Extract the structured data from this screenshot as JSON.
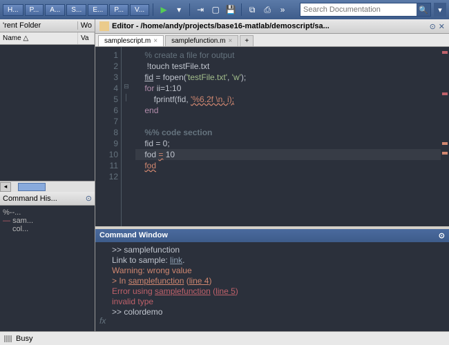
{
  "toolbar": {
    "tabs": [
      "H...",
      "P...",
      "A...",
      "S...",
      "E...",
      "P...",
      "V..."
    ],
    "search_placeholder": "Search Documentation"
  },
  "folder_panel": {
    "title": "'rent Folder",
    "tab2": "Wo",
    "cols": {
      "name": "Name △",
      "val": "Va"
    }
  },
  "history_panel": {
    "title": "Command His...",
    "lines": [
      "%--...",
      "sam...",
      "col..."
    ]
  },
  "editor": {
    "title": "Editor - /home/andy/projects/base16-matlab/demoscript/sa...",
    "tabs": [
      {
        "label": "samplescript.m",
        "active": true
      },
      {
        "label": "samplefunction.m",
        "active": false
      }
    ],
    "lines": [
      "1",
      "2",
      "3",
      "4",
      "5",
      "6",
      "7",
      "8",
      "9",
      "10",
      "11",
      "12"
    ],
    "code": {
      "l1": "    % create a file for output",
      "l2": "     !touch testFile.txt",
      "l3a": "    ",
      "l3_fid": "fid",
      "l3b": " = fopen(",
      "l3_s1": "'testFile.txt'",
      "l3c": ", ",
      "l3_s2": "'w'",
      "l3d": ");",
      "l4a": "    ",
      "l4_for": "for",
      "l4b": " ii=1:10",
      "l5a": "        fprintf(fid, ",
      "l5_warn": "'%6.2f \\n, i);",
      "l6a": "    ",
      "l6_end": "end",
      "l8": "    %% code section",
      "l9": "    fid = 0;",
      "l10a": "    fod ",
      "l10_eq": "=",
      "l10b": " 10",
      "l11a": "    ",
      "l11_fod": "fod"
    }
  },
  "command": {
    "title": "Command Window",
    "l1": ">> samplefunction",
    "l2a": "Link to sample: ",
    "l2_link": "link",
    "l2b": ".",
    "l3": "Warning: wrong value",
    "l4a": "> In ",
    "l4_fn": "samplefunction",
    "l4b": " (",
    "l4_ln": "line 4",
    "l4c": ")",
    "l5a": "Error using ",
    "l5_fn": "samplefunction",
    "l5b": " (",
    "l5_ln": "line 5",
    "l5c": ")",
    "l6": "invalid type",
    "l7": ">> colordemo",
    "fx": "fx"
  },
  "status": {
    "text": "Busy"
  }
}
